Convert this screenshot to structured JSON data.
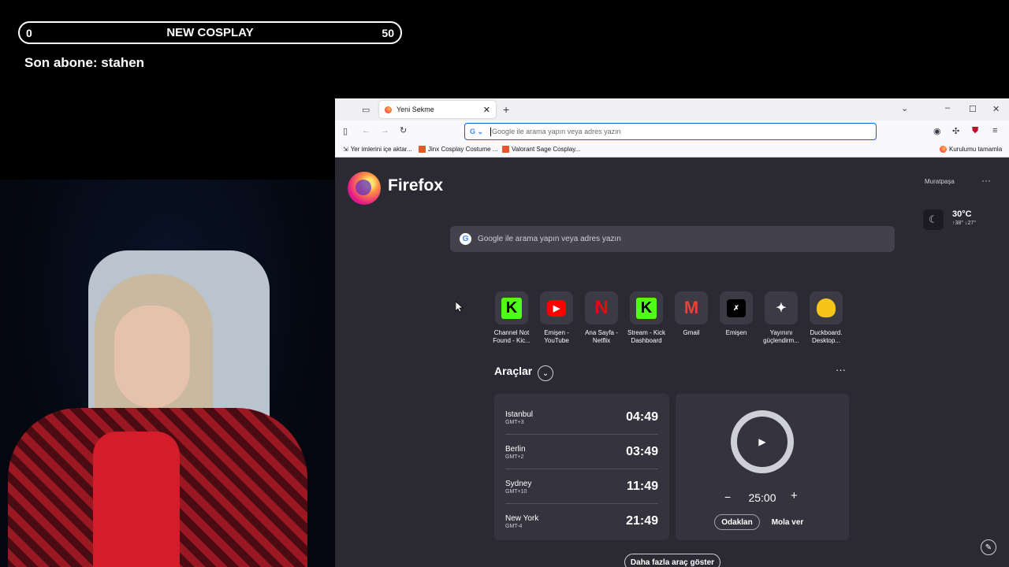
{
  "overlay": {
    "goal_start": "0",
    "goal_title": "NEW COSPLAY",
    "goal_end": "50",
    "last_sub": "Son abone: stahen"
  },
  "browser": {
    "tab_title": "Yeni Sekme",
    "url_placeholder": "Google ile arama yapın veya adres yazın",
    "bookmarks": [
      "Yer imlerini içe aktar...",
      "Jinx Cosplay Costume ...",
      "Valorant Sage Cosplay..."
    ],
    "setup_label": "Kurulumu tamamla",
    "colors": {
      "accent": "#0061e0",
      "page_bg": "#2b2a33"
    }
  },
  "newtab": {
    "brand": "Firefox",
    "search_placeholder": "Google ile arama yapın veya adres yazın",
    "shortcuts": [
      {
        "label": "Channel Not\nFound - Kic...",
        "icon": "kick-icon"
      },
      {
        "label": "Emişen -\nYouTube",
        "icon": "youtube-icon"
      },
      {
        "label": "Ana Sayfa -\nNetflix",
        "icon": "netflix-icon"
      },
      {
        "label": "Stream - Kick\nDashboard",
        "icon": "kick-icon"
      },
      {
        "label": "Gmail",
        "icon": "gmail-icon"
      },
      {
        "label": "Emişen",
        "icon": "emisen-icon"
      },
      {
        "label": "Yayınını\ngüçlendirm...",
        "icon": "discord-icon"
      },
      {
        "label": "Duckboard.\nDesktop...",
        "icon": "duck-icon"
      }
    ],
    "weather": {
      "city": "Muratpaşa",
      "temp": "30°C",
      "high_low": "↑38°  ↓27°"
    },
    "tools_title": "Araçlar",
    "clocks": [
      {
        "city": "Istanbul",
        "tz": "GMT+3",
        "time": "04:49"
      },
      {
        "city": "Berlin",
        "tz": "GMT+2",
        "time": "03:49"
      },
      {
        "city": "Sydney",
        "tz": "GMT+10",
        "time": "11:49"
      },
      {
        "city": "New York",
        "tz": "GMT-4",
        "time": "21:49"
      }
    ],
    "timer": {
      "value": "25:00",
      "focus_label": "Odaklan",
      "break_label": "Mola ver"
    },
    "more_tools": "Daha fazla araç göster"
  }
}
